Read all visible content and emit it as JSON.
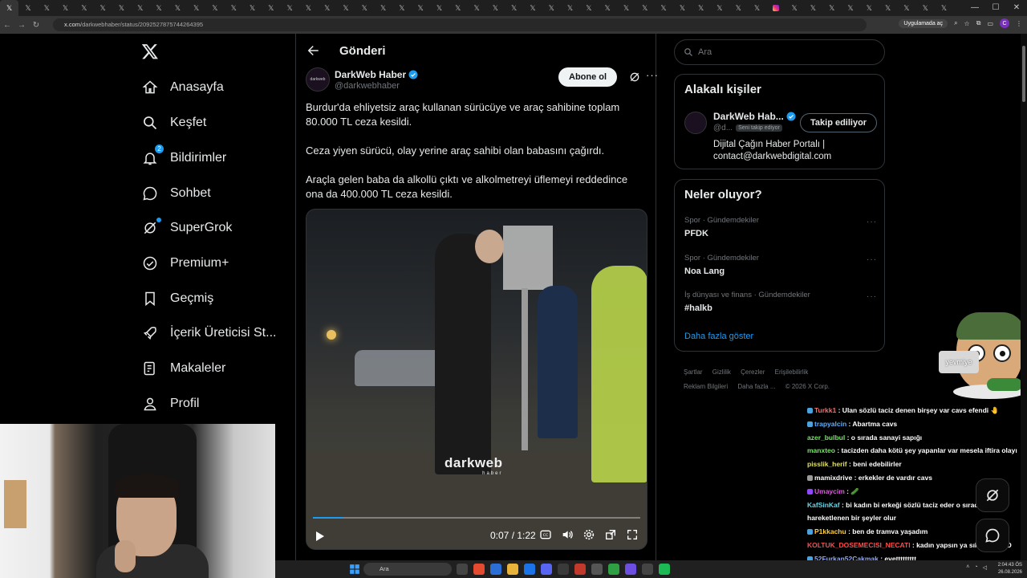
{
  "browser": {
    "tab_count": 51,
    "url_host": "x.com",
    "url_path": "/darkwebhaber/status/2092527875744264395",
    "app_pill": "Uygulamada aç",
    "profile_initial": "C"
  },
  "nav": {
    "items": [
      {
        "label": "Anasayfa",
        "icon": "home-icon"
      },
      {
        "label": "Keşfet",
        "icon": "search-icon"
      },
      {
        "label": "Bildirimler",
        "icon": "bell-icon",
        "badge": "2"
      },
      {
        "label": "Sohbet",
        "icon": "chat-icon"
      },
      {
        "label": "SuperGrok",
        "icon": "grok-icon"
      },
      {
        "label": "Premium+",
        "icon": "premium-icon"
      },
      {
        "label": "Geçmiş",
        "icon": "bookmark-icon"
      },
      {
        "label": "İçerik Üreticisi St...",
        "icon": "rocket-icon"
      },
      {
        "label": "Makaleler",
        "icon": "articles-icon"
      },
      {
        "label": "Profil",
        "icon": "profile-icon"
      }
    ]
  },
  "post": {
    "header_title": "Gönderi",
    "author_name": "DarkWeb Haber",
    "author_handle": "@darkwebhaber",
    "avatar_text": "darkweb",
    "subscribe_label": "Abone ol",
    "paragraphs": [
      "Burdur'da ehliyetsiz araç kullanan sürücüye ve araç sahibine toplam 80.000 TL ceza kesildi.",
      "Ceza yiyen sürücü, olay yerine araç sahibi olan babasını çağırdı.",
      "Araçla gelen baba da alkollü çıktı ve alkolmetreyi üflemeyi reddedince ona da 400.000 TL ceza kesildi."
    ],
    "video": {
      "watermark": "darkweb",
      "watermark_sub": "haber",
      "time": "0:07 / 1:22",
      "progress": 0.09
    }
  },
  "sidebar": {
    "search_placeholder": "Ara",
    "related_title": "Alakalı kişiler",
    "related_person": {
      "name": "DarkWeb Hab...",
      "handle": "@d...",
      "follows_you": "Seni takip ediyor",
      "follow_label": "Takip ediliyor",
      "bio_line1": "Dijital Çağın Haber Portalı |",
      "bio_line2": "contact@darkwebdigital.com"
    },
    "trends_title": "Neler oluyor?",
    "trends": [
      {
        "context": "Spor · Gündemdekiler",
        "name": "PFDK"
      },
      {
        "context": "Spor · Gündemdekiler",
        "name": "Noa Lang"
      },
      {
        "context": "İş dünyası ve finans · Gündemdekiler",
        "name": "#halkb"
      }
    ],
    "show_more": "Daha fazla göster",
    "footer_links": [
      "Şartlar",
      "Gizlilik",
      "Çerezler",
      "Erişilebilirlik",
      "Reklam Bilgileri",
      "Daha fazla ...",
      "© 2026 X Corp."
    ]
  },
  "stream": {
    "mascot_tag": "yevmiye",
    "chat": [
      {
        "user": "Turkk1",
        "color": "#ff6b6b",
        "badge": "#4aa3df",
        "text": "Ulan sözlü taciz denen birşey var cavs efendi 🤚"
      },
      {
        "user": "trapyalcin",
        "color": "#5ab0ff",
        "badge": "#4aa3df",
        "text": "Abartma cavs"
      },
      {
        "user": "azer_bulbul",
        "color": "#7be36b",
        "badge": "",
        "text": "o sırada sanayi sapığı"
      },
      {
        "user": "manxteo",
        "color": "#7be36b",
        "badge": "",
        "text": "tacizden daha kötü şey yapanlar var mesela iftira olayı"
      },
      {
        "user": "pisslik_herif",
        "color": "#e0e060",
        "badge": "",
        "text": "beni edebilirler"
      },
      {
        "user": "mamixdrive",
        "color": "#ffffff",
        "badge": "#9a9a9a",
        "text": "erkekler de vardır cavs"
      },
      {
        "user": "Umaycim",
        "color": "#e05adf",
        "badge": "#9147ff",
        "text": "🥒"
      },
      {
        "user": "KafSinKaf",
        "color": "#6bd3e3",
        "badge": "",
        "text": "bi kadın bi erkeği sözlü taciz eder o sırada erkekte hareketlenen bir şeyler olur"
      },
      {
        "user": "P1kkachu",
        "color": "#ffd23a",
        "badge": "#4aa3df",
        "text": "ben de tramva yaşadım"
      },
      {
        "user": "KOLTUK_DOSEMECISI_NECATI",
        "color": "#ff4d4d",
        "badge": "",
        "text": "kadın yapsın ya sıkıntı yok :D"
      },
      {
        "user": "52Furkan52Cakmak",
        "color": "#8fa8ff",
        "badge": "#4aa3df",
        "text": "evettttttttt"
      }
    ]
  },
  "taskbar": {
    "search_placeholder": "Ara",
    "time": "2:04:43 ÖS",
    "date": "26.08.2026"
  }
}
